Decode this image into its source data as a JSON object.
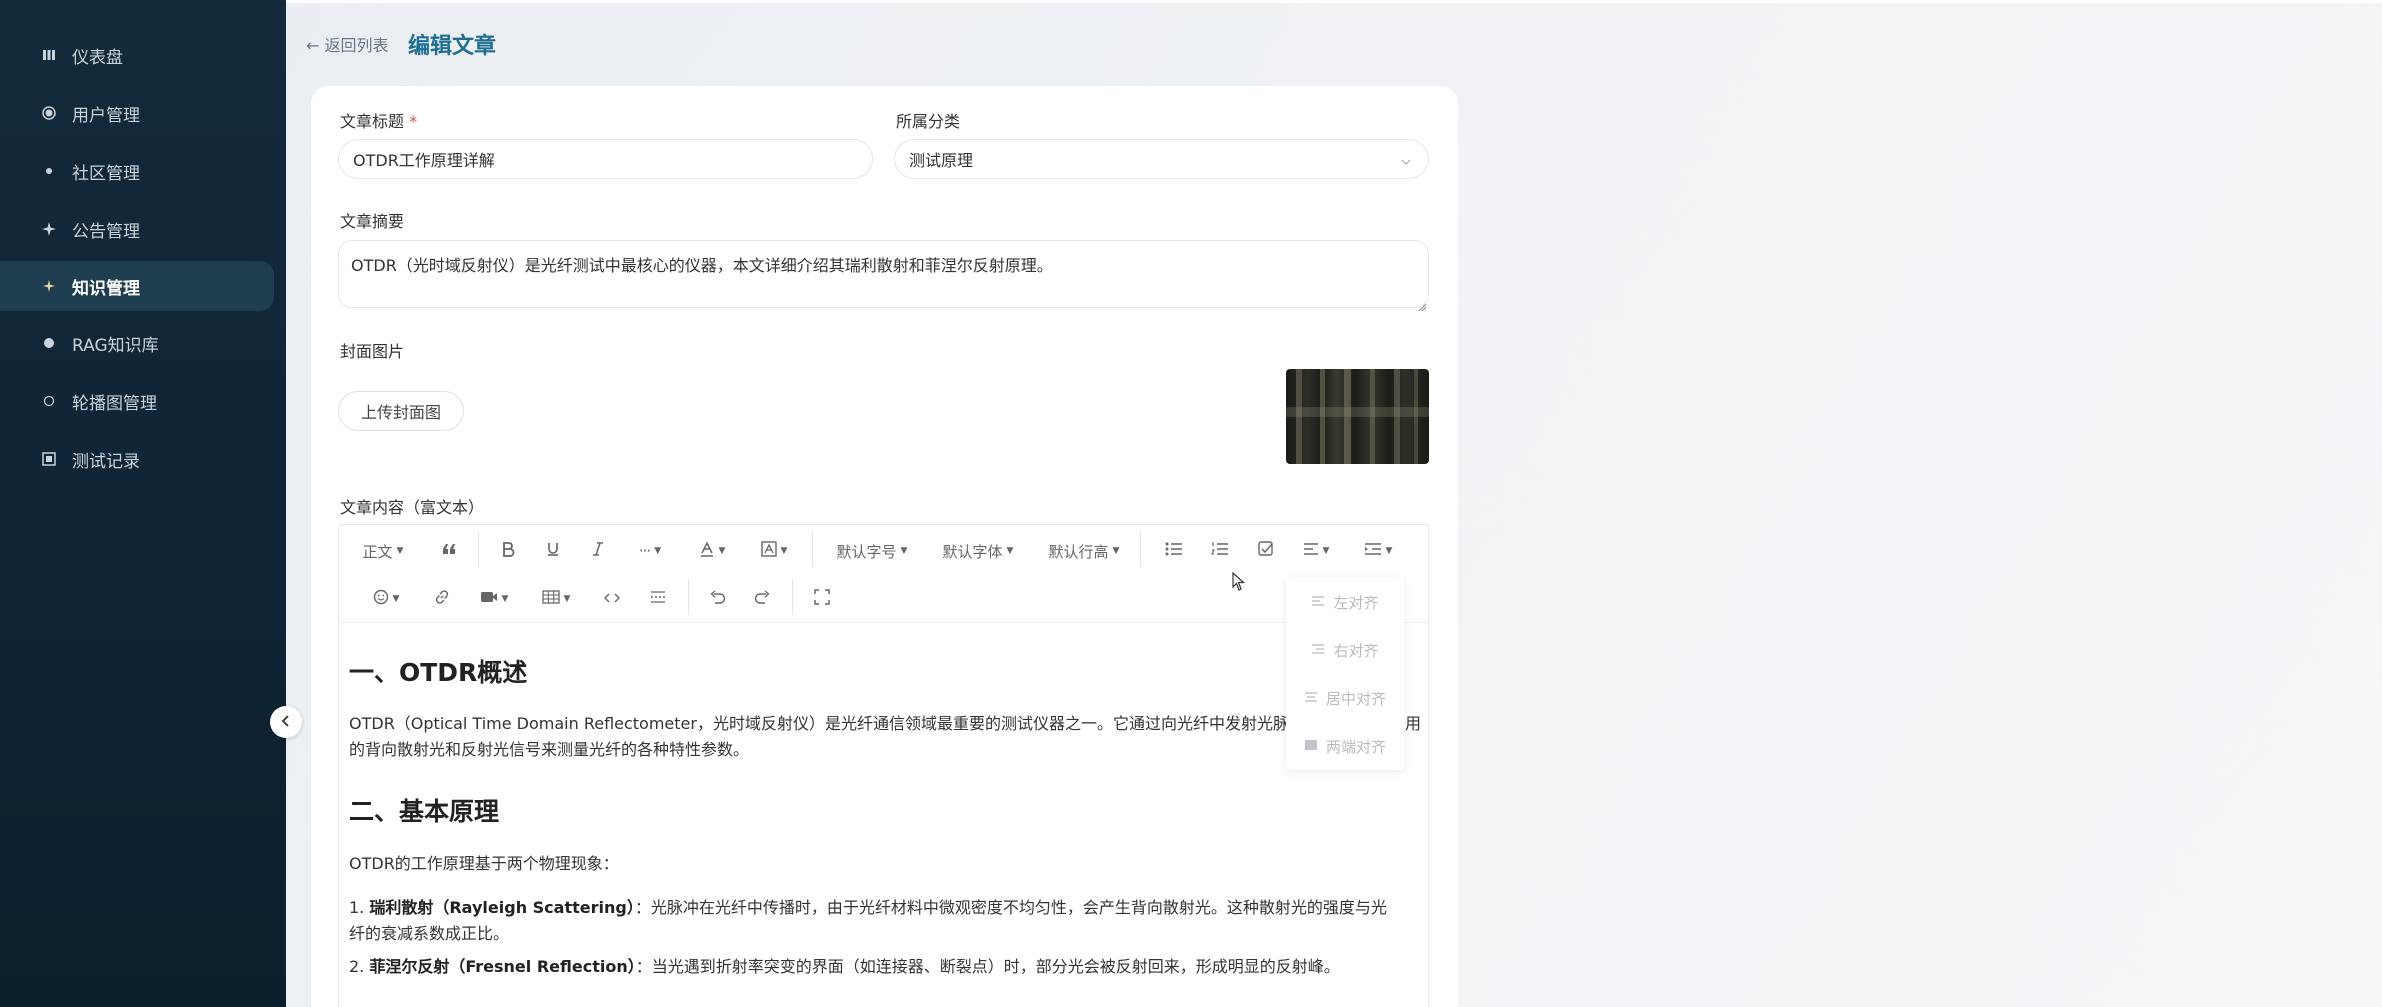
{
  "sidebar": {
    "items": [
      {
        "label": "仪表盘",
        "icon": "dashboard-icon"
      },
      {
        "label": "用户管理",
        "icon": "user-icon"
      },
      {
        "label": "社区管理",
        "icon": "community-icon"
      },
      {
        "label": "公告管理",
        "icon": "announcement-icon"
      },
      {
        "label": "知识管理",
        "icon": "knowledge-icon",
        "active": true
      },
      {
        "label": "RAG知识库",
        "icon": "rag-icon"
      },
      {
        "label": "轮播图管理",
        "icon": "carousel-icon"
      },
      {
        "label": "测试记录",
        "icon": "test-record-icon"
      }
    ]
  },
  "header": {
    "back_label": "← 返回列表",
    "title": "编辑文章"
  },
  "form": {
    "title_label": "文章标题",
    "title_required": "*",
    "title_value": "OTDR工作原理详解",
    "category_label": "所属分类",
    "category_value": "测试原理",
    "summary_label": "文章摘要",
    "summary_value": "OTDR（光时域反射仪）是光纤测试中最核心的仪器，本文详细介绍其瑞利散射和菲涅尔反射原理。",
    "cover_label": "封面图片",
    "upload_button": "上传封面图",
    "content_label": "文章内容（富文本）"
  },
  "toolbar": {
    "paragraph": "正文",
    "font_size": "默认字号",
    "font_family": "默认字体",
    "line_height": "默认行高"
  },
  "align_menu": {
    "items": [
      "左对齐",
      "右对齐",
      "居中对齐",
      "两端对齐"
    ]
  },
  "content": {
    "h1": "一、OTDR概述",
    "p1_line1": "OTDR（Optical Time Domain Reflectometer，光时域反射仪）是光纤通信领域最重要的测试仪器之一。它通过向光纤中发射光脉",
    "p1_line2_tail": "用",
    "p1_line2": "的背向散射光和反射光信号来测量光纤的各种特性参数。",
    "h2": "二、基本原理",
    "p2": "OTDR的工作原理基于两个物理现象：",
    "li1_num": "1.",
    "li1_bold": "瑞利散射（Rayleigh Scattering）",
    "li1_text": "：光脉冲在光纤中传播时，由于光纤材料中微观密度不均匀性，会产生背向散射光。这种散射光的强度与光",
    "li1_text2": "纤的衰减系数成正比。",
    "li2_num": "2.",
    "li2_bold": "菲涅尔反射（Fresnel Reflection）",
    "li2_text": "：当光遇到折射率突变的界面（如连接器、断裂点）时，部分光会被反射回来，形成明显的反射峰。"
  }
}
